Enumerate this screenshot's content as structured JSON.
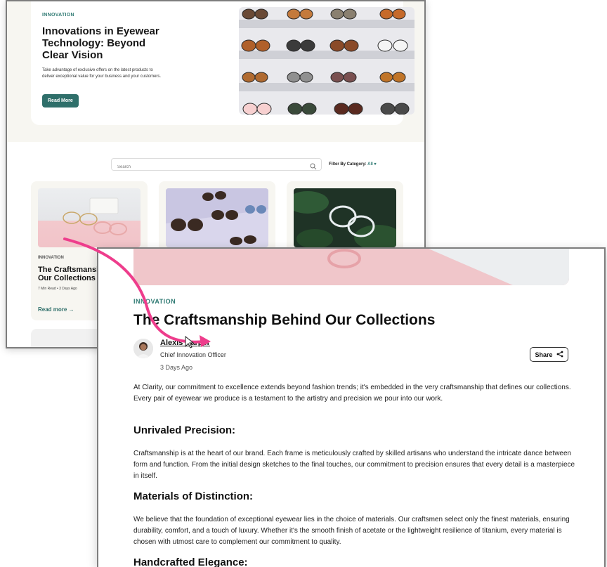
{
  "hero": {
    "tag": "INNOVATION",
    "title": "Innovations in Eyewear Technology: Beyond Clear Vision",
    "description": "Take advantage of exclusive offers on the latest products to deliver exceptional value for your business and your customers.",
    "button": "Read More"
  },
  "search": {
    "placeholder": "Search"
  },
  "filter": {
    "label": "Filter By Category:",
    "value": "All"
  },
  "cards": [
    {
      "tag": "INNOVATION",
      "title": "The Craftsmanship Behind Our Collections",
      "meta": "7 Min Read • 3 Days Ago",
      "link": "Read more →"
    }
  ],
  "article": {
    "tag": "INNOVATION",
    "title": "The Craftsmanship Behind Our Collections",
    "author": "Alexis Harper",
    "role": "Chief Innovation Officer",
    "date": "3 Days Ago",
    "share_label": "Share",
    "intro": "At Clarity, our commitment to excellence extends beyond fashion trends; it's embedded in the very craftsmanship that defines our collections. Every pair of eyewear we produce is a testament to the artistry and precision we pour into our work.",
    "sections": [
      {
        "heading": "Unrivaled Precision:",
        "body": "Craftsmanship is at the heart of our brand. Each frame is meticulously crafted by skilled artisans who understand the intricate dance between form and function. From the initial design sketches to the final touches, our commitment to precision ensures that every detail is a masterpiece in itself."
      },
      {
        "heading": "Materials of Distinction:",
        "body": "We believe that the foundation of exceptional eyewear lies in the choice of materials. Our craftsmen select only the finest materials, ensuring durability, comfort, and a touch of luxury. Whether it's the smooth finish of acetate or the lightweight resilience of titanium, every material is chosen with utmost care to complement our commitment to quality."
      },
      {
        "heading": "Handcrafted Elegance:"
      }
    ]
  },
  "colors": {
    "accent": "#2f7a73",
    "button": "#2f6f6a",
    "arrow": "#ee3d8c"
  }
}
